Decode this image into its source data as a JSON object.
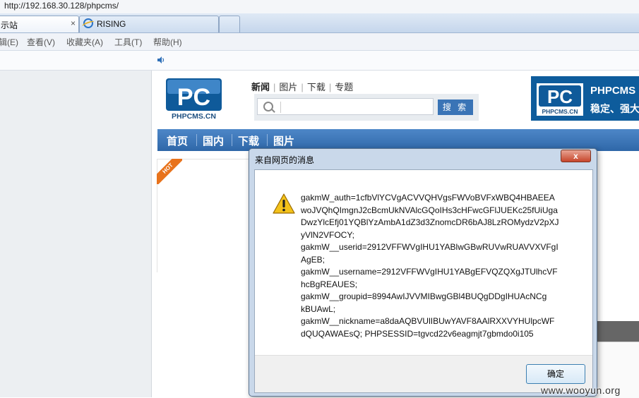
{
  "browser": {
    "url": "http://192.168.30.128/phpcms/",
    "tabs": [
      {
        "label": "示站",
        "active": true
      },
      {
        "label": "RISING",
        "active": false
      }
    ],
    "close_tab_glyph": "×",
    "menu": [
      "辑(E)",
      "查看(V)",
      "收藏夹(A)",
      "工具(T)",
      "帮助(H)"
    ]
  },
  "site": {
    "logo_text": "PHPCMS.CN",
    "top_nav": [
      "新闻",
      "图片",
      "下载",
      "专题"
    ],
    "search_button": "搜 索",
    "search_placeholder": "",
    "banner": {
      "line1": "PHPCMS",
      "line2": "稳定、强大"
    },
    "main_nav": [
      "首页",
      "国内",
      "下载",
      "图片"
    ],
    "hot_badge": "HOT"
  },
  "dialog": {
    "title": "来自网页的消息",
    "close_glyph": "x",
    "message_lines": [
      "gakmW_auth=1cfbVlYCVgACVVQHVgsFWVoBVFxWBQ4HBAEEA",
      "woJVQhQImgnJ2cBcmUkNVAlcGQoIHs3cHFwcGFlJUEKc25fUiUga",
      "DwzYlcEfj01YQBlYzAmbA1dZ3d3ZnomcDR6bAJ8LzROMydzV2pXJ",
      "yVlN2VFOCY;",
      "gakmW__userid=2912VFFWVgIHU1YABlwGBwRUVwRUAVVXVFgI",
      "AgEB;",
      "gakmW__username=2912VFFWVgIHU1YABgEFVQZQXgJTUlhcVF",
      "hcBgREAUES;",
      "gakmW__groupid=8994AwIJVVMIBwgGBl4BUQgDDgIHUAcNCg",
      "kBUAwL;",
      "gakmW__nickname=a8daAQBVUlIBUwYAVF8AAlRXXVYHUlpcWF",
      "dQUQAWAEsQ; PHPSESSID=tgvcd22v6eagmjt7gbmdo0i105"
    ],
    "ok_button": "确定",
    "icon": "warning-icon"
  },
  "watermark": "www.wooyun.org",
  "colors": {
    "nav_blue": "#2f67a8",
    "banner_blue": "#0e5c9c",
    "hot_orange": "#e8731c"
  }
}
